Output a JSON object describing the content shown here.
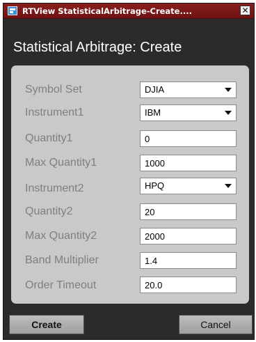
{
  "window": {
    "title": "RTView StatisticalArbitrage-Create....",
    "close_glyph": "✕",
    "icon": "app-icon"
  },
  "dialog": {
    "heading": "Statistical Arbitrage: Create"
  },
  "form": {
    "symbol_set": {
      "label": "Symbol Set",
      "value": "DJIA"
    },
    "instrument1": {
      "label": "Instrument1",
      "value": "IBM"
    },
    "quantity1": {
      "label": "Quantity1",
      "value": "0"
    },
    "max_quantity1": {
      "label": "Max Quantity1",
      "value": "1000"
    },
    "instrument2": {
      "label": "Instrument2",
      "value": "HPQ"
    },
    "quantity2": {
      "label": "Quantity2",
      "value": "20"
    },
    "max_quantity2": {
      "label": "Max Quantity2",
      "value": "2000"
    },
    "band_multiplier": {
      "label": "Band Multiplier",
      "value": "1.4"
    },
    "order_timeout": {
      "label": "Order Timeout",
      "value": "20.0"
    }
  },
  "buttons": {
    "create": "Create",
    "cancel": "Cancel"
  },
  "colors": {
    "titlebar": "#8a1f1f",
    "window_background": "#2b2b2b",
    "panel": "#c9c9c9",
    "label_text": "#7f7f7f"
  }
}
